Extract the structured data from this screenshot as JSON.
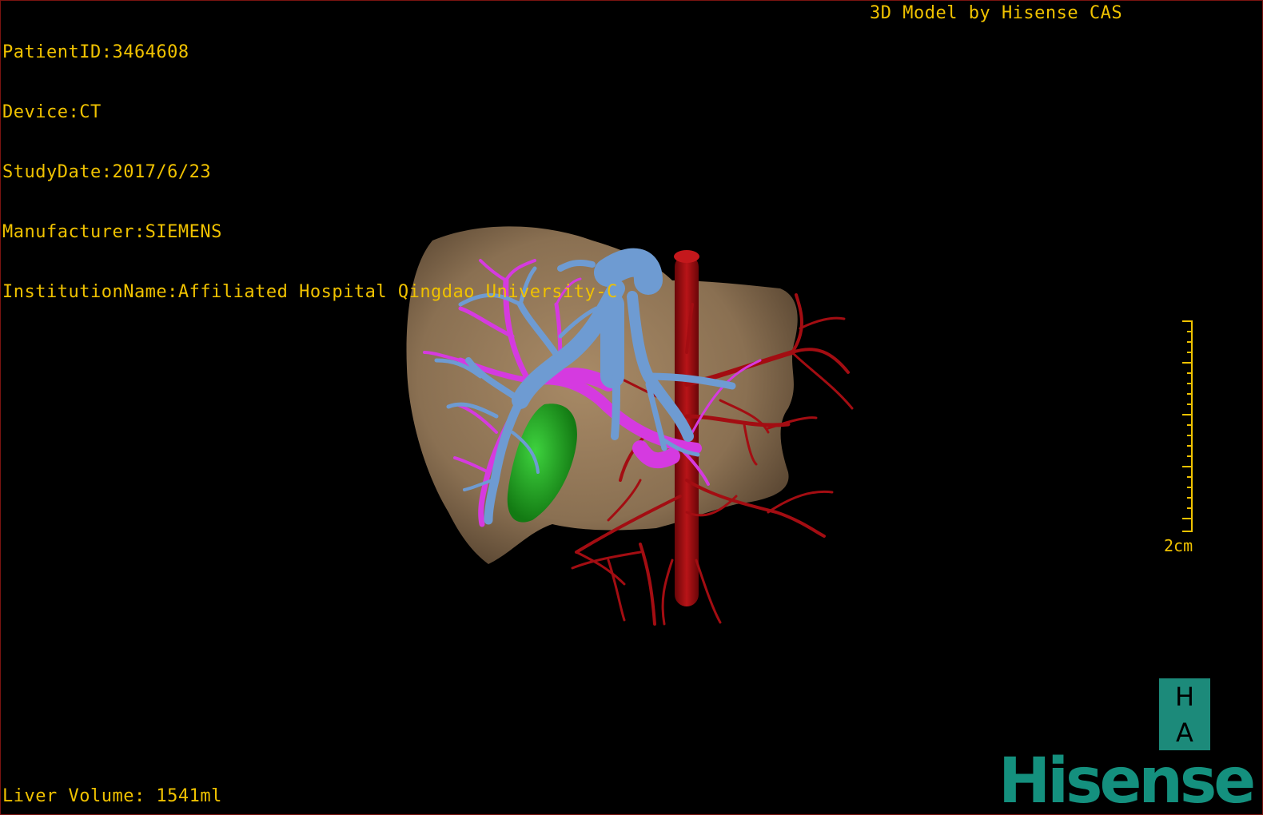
{
  "overlay": {
    "patient_id": "PatientID:3464608",
    "device": "Device:CT",
    "study_date": "StudyDate:2017/6/23",
    "manufacturer": "Manufacturer:SIEMENS",
    "institution": "InstitutionName:Affiliated Hospital Qingdao University-C",
    "credit": "3D Model by Hisense CAS",
    "liver_volume": "Liver Volume: 1541ml"
  },
  "scale": {
    "label": "2cm"
  },
  "orientation": {
    "top": "H",
    "bottom": "A"
  },
  "logo": {
    "text": "Hisense"
  },
  "colors": {
    "overlay_text": "#f0c200",
    "liver": "#8c7456",
    "portal_vein": "#6e9bd2",
    "hepatic_vein": "#d43adc",
    "artery": "#a00e12",
    "gallbladder": "#1fa31f",
    "brand": "#14907e"
  }
}
